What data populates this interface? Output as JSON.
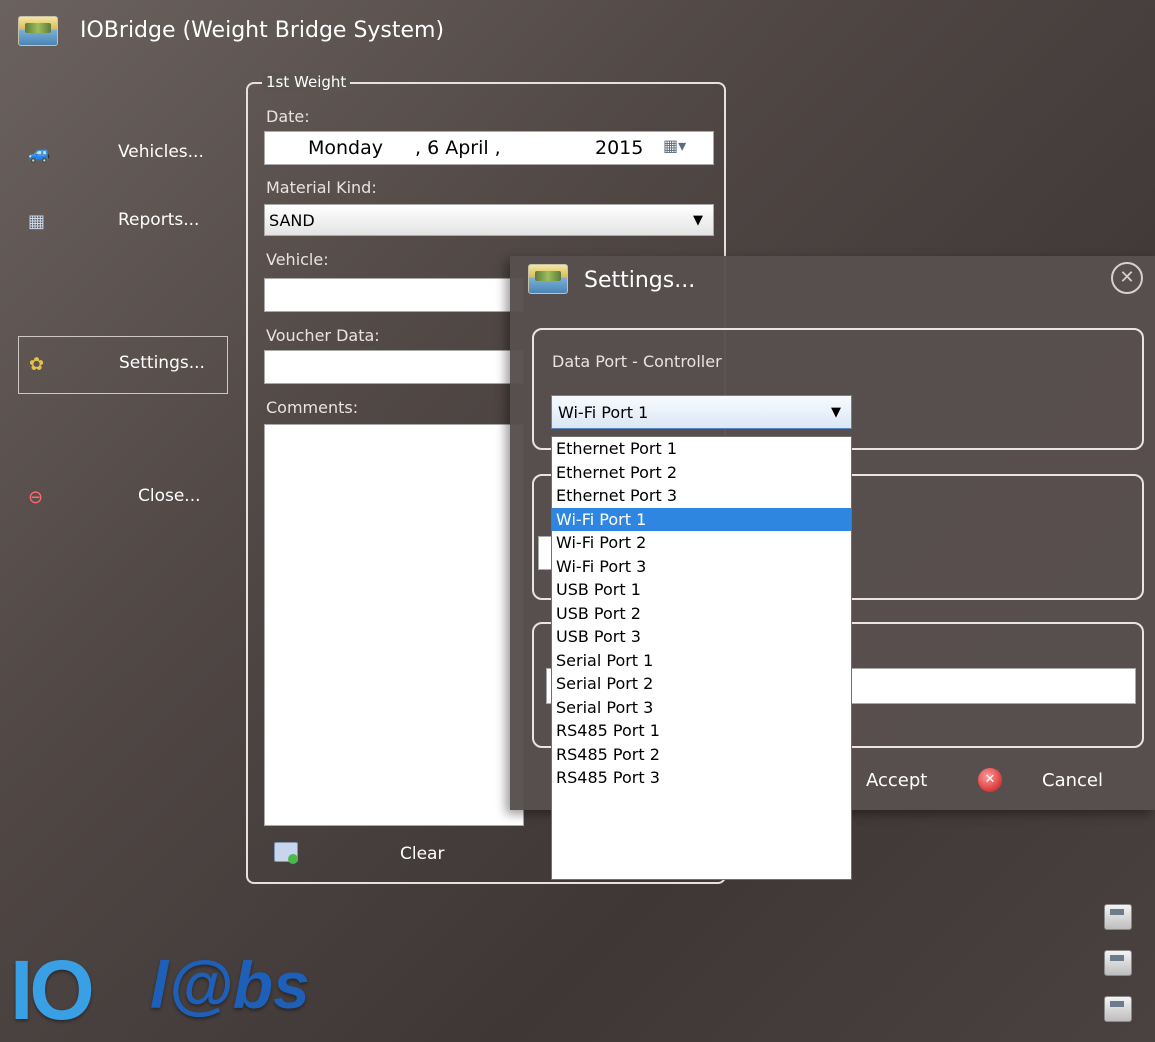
{
  "window": {
    "title": "IOBridge (Weight Bridge System)"
  },
  "sidebar": {
    "items": [
      {
        "label": "Vehicles...",
        "icon": "car-icon"
      },
      {
        "label": "Reports...",
        "icon": "table-icon"
      },
      {
        "label": "Settings...",
        "icon": "gear-icon",
        "active": true
      },
      {
        "label": "Close...",
        "icon": "close-circle-icon"
      }
    ]
  },
  "form": {
    "legend": "1st Weight",
    "date_label": "Date:",
    "date_weekday": "Monday",
    "date_day_month": ", 6 April ,",
    "date_year": "2015",
    "material_label": "Material Kind:",
    "material_value": "SAND",
    "vehicle_label": "Vehicle:",
    "vehicle_value": "",
    "voucher_label": "Voucher Data:",
    "voucher_value": "",
    "comments_label": "Comments:",
    "comments_value": "",
    "clear_label": "Clear"
  },
  "settings_dialog": {
    "title": "Settings...",
    "data_port_label": "Data Port - Controller",
    "data_port_selected": "Wi-Fi Port 1",
    "data_port_options": [
      "Ethernet Port 1",
      "Ethernet Port 2",
      "Ethernet Port 3",
      "Wi-Fi Port 1",
      "Wi-Fi Port 2",
      "Wi-Fi Port 3",
      "USB Port 1",
      "USB Port 2",
      "USB Port 3",
      "Serial Port 1",
      "Serial Port 2",
      "Serial Port 3",
      "RS485 Port 1",
      "RS485 Port 2",
      "RS485 Port 3"
    ],
    "selected_index": 3,
    "accept_label": "Accept",
    "cancel_label": "Cancel"
  },
  "logo": {
    "text_io": "IO",
    "text_labs": "l@bs"
  },
  "colors": {
    "accent_selection": "#2f86e0",
    "background": "#514846"
  }
}
